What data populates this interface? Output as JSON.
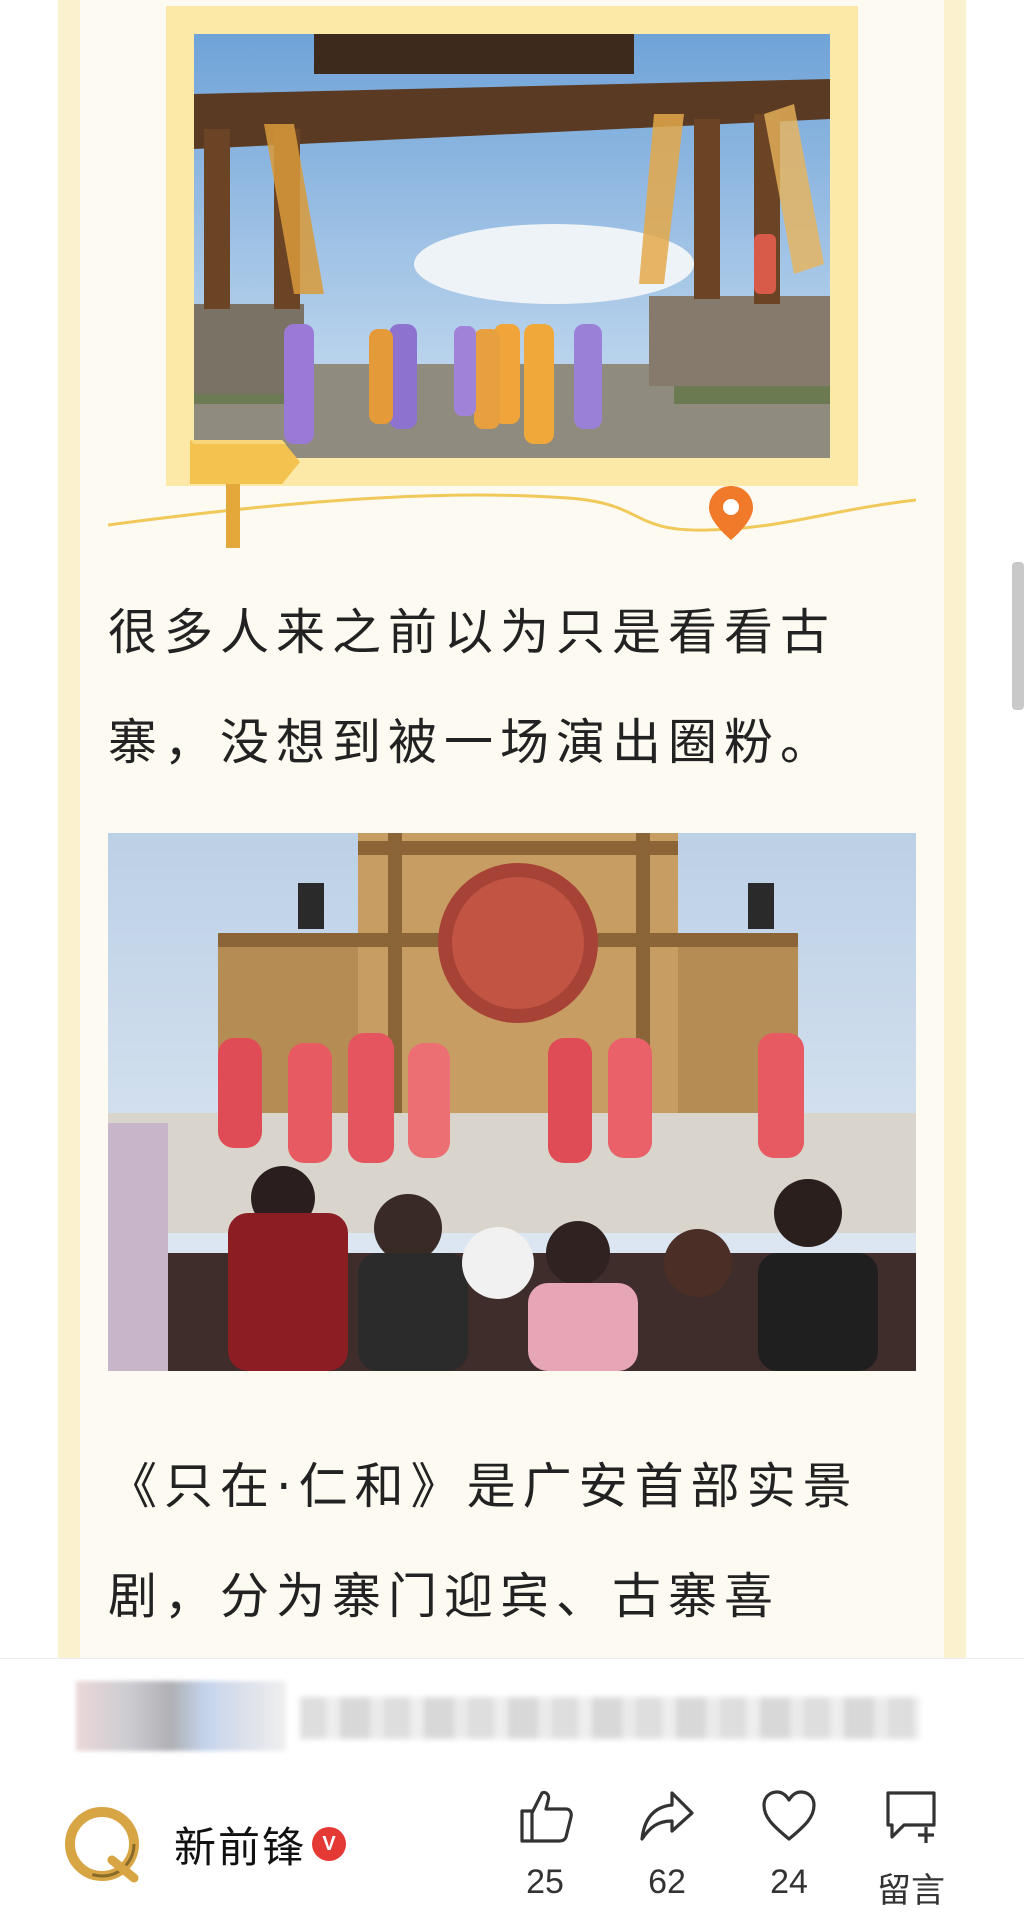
{
  "article": {
    "paragraph_1": "很多人来之前以为只是看看古寨，没想到被一场演出圈粉。",
    "paragraph_2": "《只在·仁和》是广安首部实景剧，分为寨门迎宾、古寨喜",
    "image_1": {
      "icon": "ancient-village-gate-photo"
    },
    "image_2": {
      "icon": "dance-performance-photo"
    }
  },
  "decorations": {
    "signpost_icon": "signpost-icon",
    "pin_icon": "map-pin-icon",
    "pin_color": "#f07a2a"
  },
  "footer": {
    "author": {
      "name": "新前锋",
      "verified_badge": "V",
      "logo_icon": "brand-logo-icon"
    },
    "actions": [
      {
        "icon": "thumbs-up-icon",
        "label": "25"
      },
      {
        "icon": "share-icon",
        "label": "62"
      },
      {
        "icon": "heart-icon",
        "label": "24"
      },
      {
        "icon": "comment-icon",
        "label": "留言"
      }
    ]
  },
  "colors": {
    "article_bg": "#fdfaf2",
    "frame": "#fce9a8",
    "verified": "#e53935"
  }
}
